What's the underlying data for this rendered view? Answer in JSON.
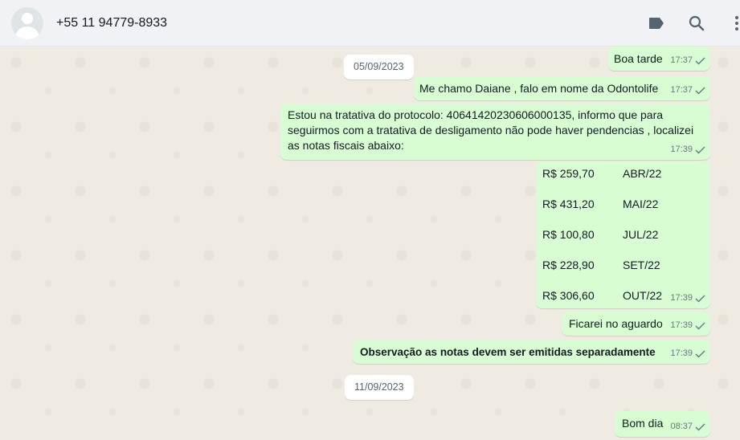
{
  "header": {
    "contact_name": "+55 11 94779-8933",
    "icons": [
      "label-icon",
      "search-icon",
      "menu-icon"
    ]
  },
  "dates": [
    "05/09/2023",
    "11/09/2023"
  ],
  "messages": [
    {
      "text": "Boa tarde",
      "time": "17:37"
    },
    {
      "text": "Me chamo Daiane , falo em nome da Odontolife",
      "time": "17:37"
    },
    {
      "text": "Estou na tratativa do protocolo: 40641420230606000135, informo que para seguirmos com a tratativa de desligamento não pode haver pendencias , localizei as notas fiscais abaixo:",
      "time": "17:39"
    },
    {
      "invoices": [
        {
          "amount": "R$ 259,70",
          "month": "ABR/22"
        },
        {
          "amount": "R$ 431,20",
          "month": "MAI/22"
        },
        {
          "amount": "R$ 100,80",
          "month": "JUL/22"
        },
        {
          "amount": "R$ 228,90",
          "month": "SET/22"
        },
        {
          "amount": "R$ 306,60",
          "month": "OUT/22"
        }
      ],
      "time": "17:39"
    },
    {
      "text": "Ficarei no aguardo",
      "time": "17:39"
    },
    {
      "text": "Observação as notas devem ser emitidas separadamente",
      "time": "17:39"
    },
    {
      "text": "Bom dia",
      "time": "08:37"
    }
  ],
  "colors": {
    "outgoing_bubble": "#d9fdd3",
    "chat_bg": "#efeae2",
    "header_bg": "#f0f2f5",
    "tick": "#667781"
  }
}
